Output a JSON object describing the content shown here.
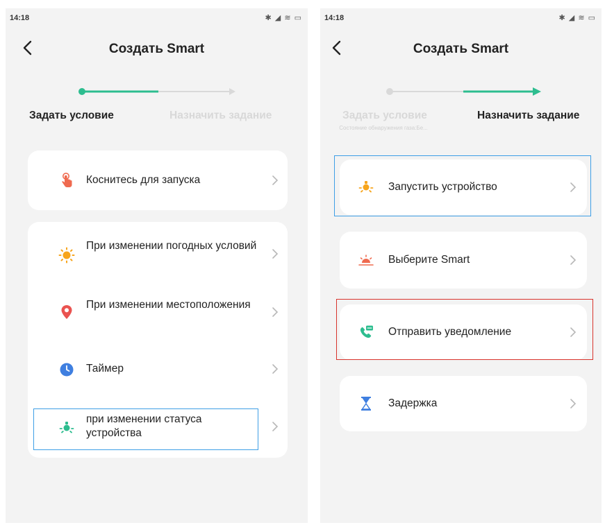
{
  "status_bar": {
    "time": "14:18",
    "icons": "✱ ◢ ≋ ▭"
  },
  "left": {
    "title": "Создать Smart",
    "steps": {
      "current": "Задать условие",
      "next": "Назначить задание"
    },
    "touch_card": {
      "label": "Коснитесь для запуска"
    },
    "conditions": [
      {
        "label": "При изменении погодных условий"
      },
      {
        "label": "При изменении местоположения"
      },
      {
        "label": "Таймер"
      },
      {
        "label": "при изменении статуса устройства"
      }
    ]
  },
  "right": {
    "title": "Создать Smart",
    "steps": {
      "previous": "Задать условие",
      "previous_sub": "Состояние обнаружения газа:Бе...",
      "current": "Назначить задание"
    },
    "actions": [
      {
        "label": "Запустить устройство"
      },
      {
        "label": "Выберите Smart"
      },
      {
        "label": "Отправить уведомление"
      },
      {
        "label": "Задержка"
      }
    ]
  },
  "colors": {
    "accent": "#2dbd8f",
    "highlight_blue": "#3d9ee6",
    "highlight_red": "#d8332c"
  }
}
